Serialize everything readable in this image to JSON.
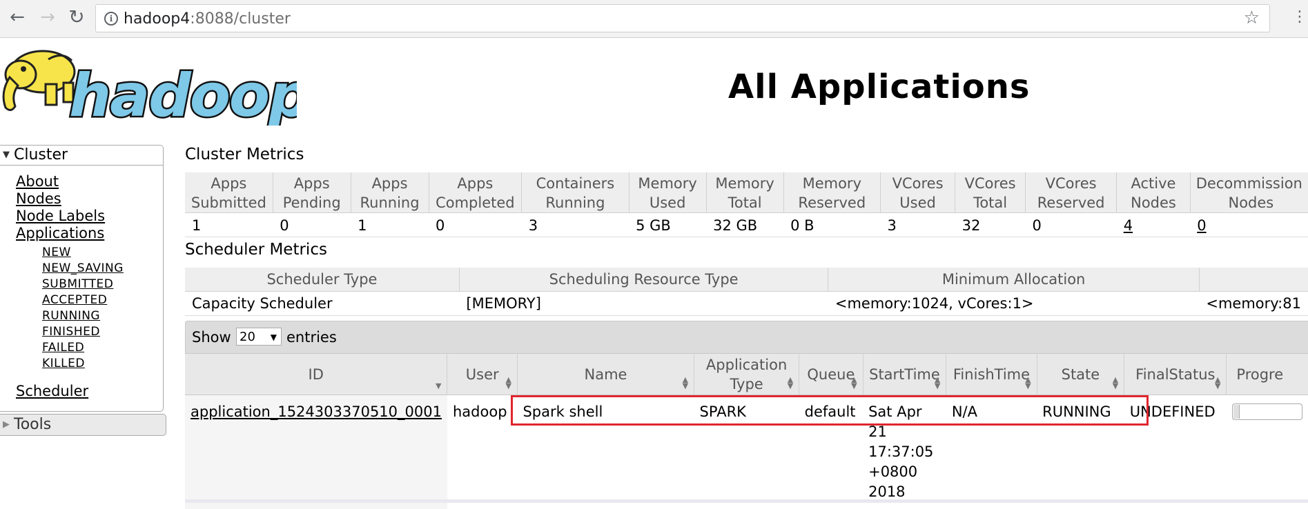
{
  "browser": {
    "url_host": "hadoop4",
    "url_rest": ":8088/cluster"
  },
  "logo_text": "hadoop",
  "page_title": "All Applications",
  "sidebar": {
    "cluster_label": "Cluster",
    "links": [
      "About",
      "Nodes",
      "Node Labels",
      "Applications"
    ],
    "app_states": [
      "NEW",
      "NEW_SAVING",
      "SUBMITTED",
      "ACCEPTED",
      "RUNNING",
      "FINISHED",
      "FAILED",
      "KILLED"
    ],
    "scheduler": "Scheduler",
    "tools_label": "Tools"
  },
  "cluster_metrics": {
    "title": "Cluster Metrics",
    "headers": [
      [
        "Apps",
        "Submitted"
      ],
      [
        "Apps",
        "Pending"
      ],
      [
        "Apps",
        "Running"
      ],
      [
        "Apps",
        "Completed"
      ],
      [
        "Containers",
        "Running"
      ],
      [
        "Memory",
        "Used"
      ],
      [
        "Memory",
        "Total"
      ],
      [
        "Memory",
        "Reserved"
      ],
      [
        "VCores",
        "Used"
      ],
      [
        "VCores",
        "Total"
      ],
      [
        "VCores",
        "Reserved"
      ],
      [
        "Active",
        "Nodes"
      ],
      [
        "Decommission",
        "Nodes"
      ]
    ],
    "values": [
      "1",
      "0",
      "1",
      "0",
      "3",
      "5 GB",
      "32 GB",
      "0 B",
      "3",
      "32",
      "0",
      "4",
      "0"
    ]
  },
  "scheduler_metrics": {
    "title": "Scheduler Metrics",
    "headers": [
      "Scheduler Type",
      "Scheduling Resource Type",
      "Minimum Allocation",
      ""
    ],
    "values": [
      "Capacity Scheduler",
      "[MEMORY]",
      "<memory:1024, vCores:1>",
      "<memory:81"
    ]
  },
  "apps_table": {
    "show_label": "Show",
    "entries_value": "20",
    "entries_label": "entries",
    "headers": [
      "ID",
      "User",
      "Name",
      [
        "Application",
        "Type"
      ],
      "Queue",
      "StartTime",
      "FinishTime",
      "State",
      "FinalStatus",
      "Progre"
    ],
    "row": {
      "id": "application_1524303370510_0001",
      "user": "hadoop",
      "name": "Spark shell",
      "type": "SPARK",
      "queue": "default",
      "start_lines": [
        "Sat Apr",
        "21",
        "17:37:05",
        "+0800",
        "2018"
      ],
      "finish": "N/A",
      "state": "RUNNING",
      "final_status": "UNDEFINED"
    }
  },
  "colors": {
    "highlight": "#e0262f",
    "logo_blue": "#7ec8e8",
    "logo_yellow": "#f7e44a"
  }
}
